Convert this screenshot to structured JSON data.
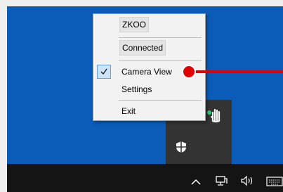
{
  "context_menu": {
    "items": [
      {
        "label": "ZKOO",
        "style": "boxed"
      },
      {
        "label": "Connected",
        "style": "boxed"
      },
      {
        "label": "Camera View",
        "checked": true
      },
      {
        "label": "Settings"
      },
      {
        "label": "Exit"
      }
    ]
  },
  "tray_icons": [
    "hand-gesture-icon",
    "shield-icon"
  ],
  "taskbar_icons": [
    "chevron-up-icon",
    "network-icon",
    "volume-icon",
    "keyboard-icon"
  ],
  "colors": {
    "desktop": "#0a5cb8",
    "taskbar": "#141414",
    "tray_popup": "#333333",
    "menu_bg": "#f2f2f2",
    "highlight_pointer": "#e00000"
  }
}
